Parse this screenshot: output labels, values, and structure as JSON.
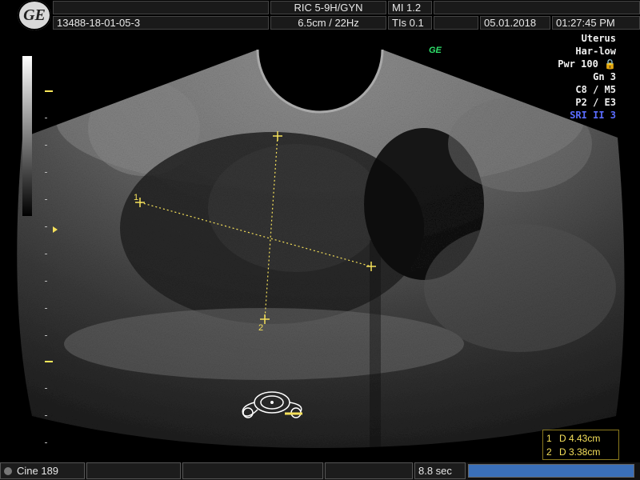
{
  "header": {
    "logo": "GE",
    "patient_id": "13488-18-01-05-3",
    "probe": "RIC 5-9H/GYN",
    "depth_freq": "6.5cm / 22Hz",
    "mi": "MI  1.2",
    "tis": "TIs  0.1",
    "date": "05.01.2018",
    "time": "01:27:45 PM"
  },
  "params": {
    "exam": "Uterus",
    "harmonic": "Har-low",
    "power": "Pwr 100 🔒",
    "gain": "Gn  3",
    "c_m": "C8 / M5",
    "p_e": "P2 / E3",
    "sri": "SRI II 3"
  },
  "ge_mark": "GE",
  "measurements": {
    "m1": {
      "n": "1",
      "text": "D 4.43cm"
    },
    "m2": {
      "n": "2",
      "text": "D 3.38cm"
    },
    "caliper1_label": "1",
    "caliper2_label": "2"
  },
  "bottom": {
    "cine": "Cine 189",
    "duration": "8.8 sec",
    "cine_progress": 1.0
  },
  "colors": {
    "caliper": "#f5e05a",
    "sri": "#5a6cff",
    "ge_mark": "#2ee06a",
    "progress": "#3a6fb8"
  }
}
